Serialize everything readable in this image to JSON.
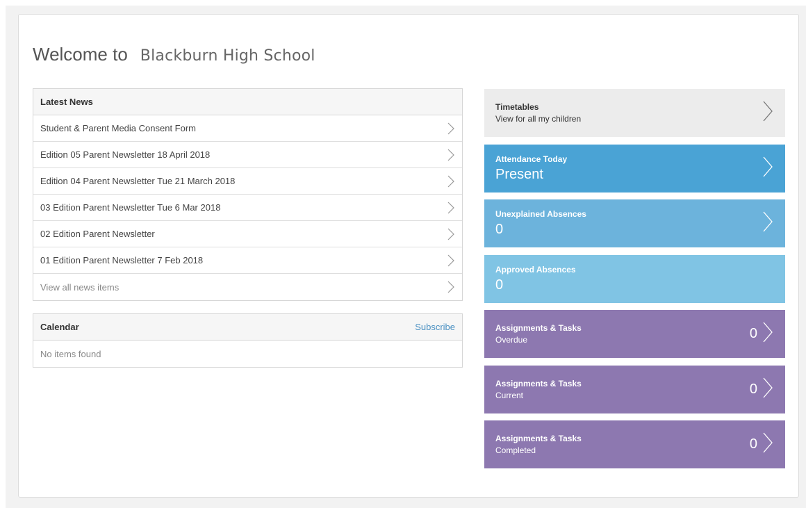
{
  "welcome": {
    "prefix": "Welcome to",
    "school": "Blackburn High School"
  },
  "news": {
    "title": "Latest News",
    "items": [
      "Student & Parent Media Consent Form",
      "Edition 05 Parent Newsletter 18 April 2018",
      "Edition 04 Parent Newsletter Tue 21 March 2018",
      "03 Edition Parent Newsletter Tue 6 Mar 2018",
      "02 Edition Parent Newsletter",
      "01 Edition Parent Newsletter 7 Feb 2018"
    ],
    "view_all": "View all news items"
  },
  "calendar": {
    "title": "Calendar",
    "subscribe": "Subscribe",
    "empty": "No items found"
  },
  "tiles": {
    "timetables": {
      "title": "Timetables",
      "sub": "View for all my children"
    },
    "attendance": {
      "title": "Attendance Today",
      "value": "Present"
    },
    "unexplained": {
      "title": "Unexplained Absences",
      "value": "0"
    },
    "approved": {
      "title": "Approved Absences",
      "value": "0"
    },
    "overdue": {
      "title": "Assignments & Tasks",
      "sub": "Overdue",
      "count": "0"
    },
    "current": {
      "title": "Assignments & Tasks",
      "sub": "Current",
      "count": "0"
    },
    "completed": {
      "title": "Assignments & Tasks",
      "sub": "Completed",
      "count": "0"
    }
  },
  "colors": {
    "grey_tile": "#ececec",
    "attendance_blue": "#4aa3d5",
    "unexplained_blue": "#6cb3dc",
    "approved_blue": "#80c4e4",
    "tasks_purple": "#8d78b0",
    "link_blue": "#4a90c2"
  },
  "icons": {
    "row_chevron": "chevron-right-icon"
  }
}
